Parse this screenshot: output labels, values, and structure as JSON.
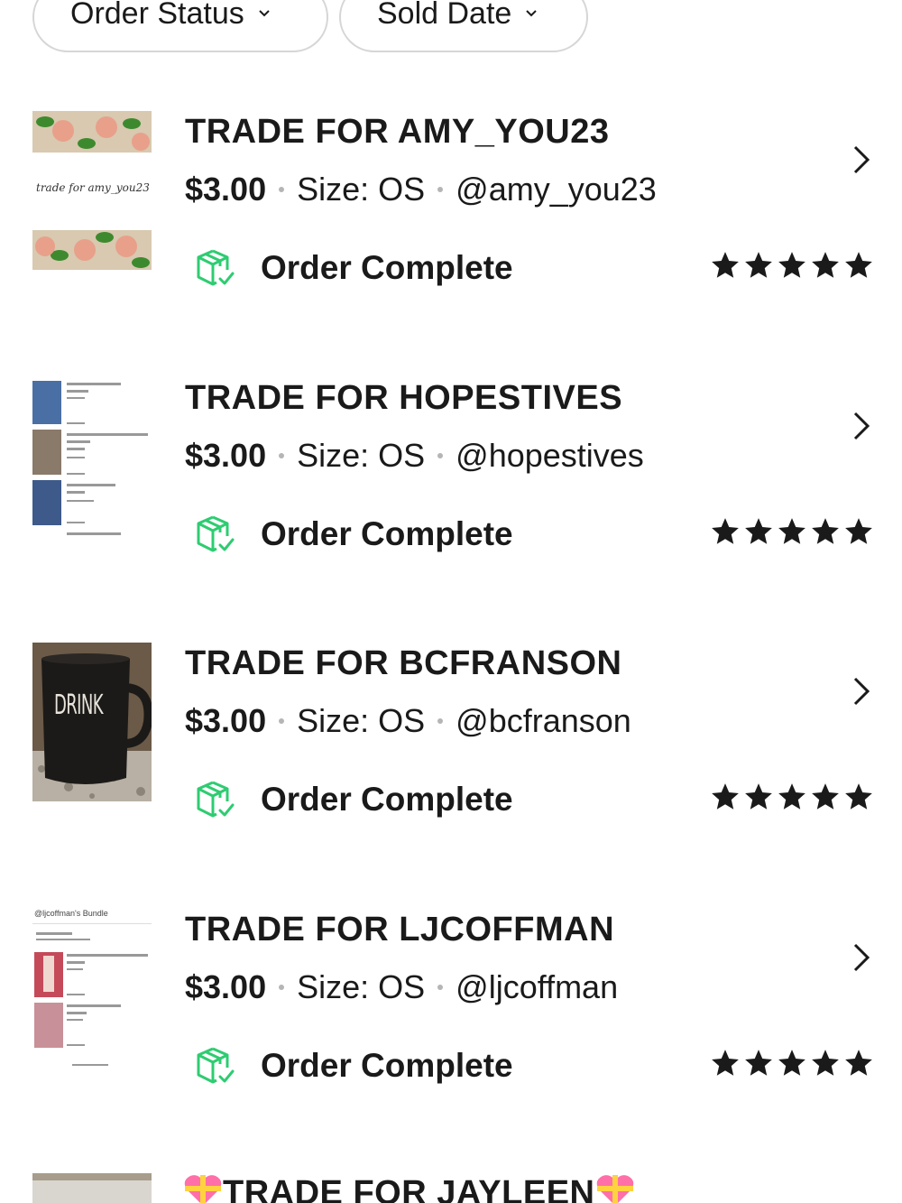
{
  "filters": {
    "order_status": "Order Status",
    "sold_date": "Sold Date"
  },
  "orders": [
    {
      "title": "TRADE FOR AMY_YOU23",
      "price": "$3.00",
      "size": "Size: OS",
      "user": "@amy_you23",
      "status": "Order Complete",
      "rating": 5,
      "thumb_caption": "trade for amy_you23"
    },
    {
      "title": "TRADE FOR HOPESTIVES",
      "price": "$3.00",
      "size": "Size: OS",
      "user": "@hopestives",
      "status": "Order Complete",
      "rating": 5,
      "thumb_caption": ""
    },
    {
      "title": "TRADE FOR BCFRANSON",
      "price": "$3.00",
      "size": "Size: OS",
      "user": "@bcfranson",
      "status": "Order Complete",
      "rating": 5,
      "thumb_caption": "DRINK"
    },
    {
      "title": "TRADE FOR LJCOFFMAN",
      "price": "$3.00",
      "size": "Size: OS",
      "user": "@ljcoffman",
      "status": "Order Complete",
      "rating": 5,
      "thumb_caption": "@ljcoffman's Bundle"
    }
  ],
  "partial_order": {
    "title": "TRADE FOR JAYLEEN"
  },
  "colors": {
    "status_green": "#2ecc71",
    "text": "#1a1a1a",
    "divider_dot": "#b5b5b5"
  },
  "icons": {
    "status": "package-check-icon",
    "arrow": "chevron-right-icon",
    "star": "star-icon",
    "filter_chevron": "chevron-down-icon"
  }
}
